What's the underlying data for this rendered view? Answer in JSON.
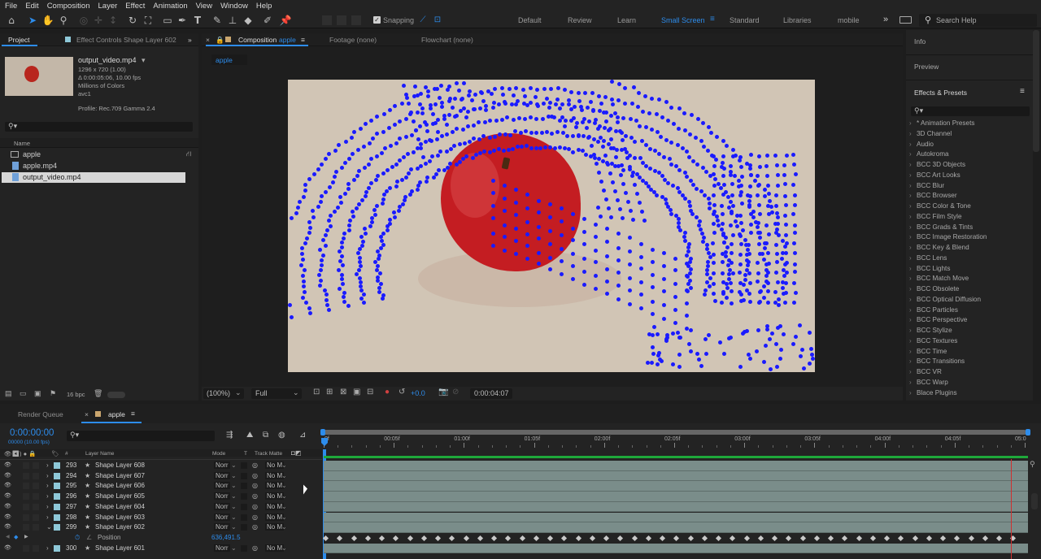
{
  "menu": [
    "File",
    "Edit",
    "Composition",
    "Layer",
    "Effect",
    "Animation",
    "View",
    "Window",
    "Help"
  ],
  "toolbar": {
    "snapping_label": "Snapping"
  },
  "workspaces": [
    "Default",
    "Review",
    "Learn",
    "Small Screen",
    "Standard",
    "Libraries",
    "mobile"
  ],
  "active_workspace": "Small Screen",
  "help": {
    "placeholder": "Search Help"
  },
  "project": {
    "tab_project": "Project",
    "tab_effect_controls": "Effect Controls Shape Layer 602",
    "file_name": "output_video.mp4",
    "file_details": [
      "1296 x 720 (1.00)",
      "Δ 0:00:05:06, 10.00 fps",
      "Millions of Colors",
      "avc1"
    ],
    "profile": "Profile: Rec.709 Gamma 2.4",
    "col_name": "Name",
    "items": [
      "apple",
      "apple.mp4",
      "output_video.mp4"
    ],
    "bpc": "16 bpc"
  },
  "composition": {
    "tab_label": "Composition",
    "comp_name": "apple",
    "footage_tab": "Footage (none)",
    "flowchart_tab": "Flowchart (none)",
    "crumb": "apple",
    "zoom": "(100%)",
    "resolution": "Full",
    "exposure": "+0.0",
    "timecode": "0:00:04:07"
  },
  "right_panel": {
    "info": "Info",
    "preview": "Preview",
    "effects_title": "Effects & Presets",
    "effects": [
      "* Animation Presets",
      "3D Channel",
      "Audio",
      "Autokroma",
      "BCC 3D Objects",
      "BCC Art Looks",
      "BCC Blur",
      "BCC Browser",
      "BCC Color & Tone",
      "BCC Film Style",
      "BCC Grads & Tints",
      "BCC Image Restoration",
      "BCC Key & Blend",
      "BCC Lens",
      "BCC Lights",
      "BCC Match Move",
      "BCC Obsolete",
      "BCC Optical Diffusion",
      "BCC Particles",
      "BCC Perspective",
      "BCC Stylize",
      "BCC Textures",
      "BCC Time",
      "BCC Transitions",
      "BCC VR",
      "BCC Warp",
      "Blace Plugins"
    ]
  },
  "timeline": {
    "render_queue": "Render Queue",
    "comp_tab": "apple",
    "timecode": "0:00:00:00",
    "fps": "00000 (10.00 fps)",
    "col_layer_name": "Layer Name",
    "col_mode": "Mode",
    "col_t": "T",
    "col_track_matte": "Track Matte",
    "ruler": [
      "0f",
      "00:05f",
      "01:00f",
      "01:05f",
      "02:00f",
      "02:05f",
      "03:00f",
      "03:05f",
      "04:00f",
      "04:05f",
      "05:0"
    ],
    "layers": [
      {
        "num": "293",
        "name": "Shape Layer 608",
        "mode": "Norr",
        "matte": "No M"
      },
      {
        "num": "294",
        "name": "Shape Layer 607",
        "mode": "Norr",
        "matte": "No M"
      },
      {
        "num": "295",
        "name": "Shape Layer 606",
        "mode": "Norr",
        "matte": "No M"
      },
      {
        "num": "296",
        "name": "Shape Layer 605",
        "mode": "Norr",
        "matte": "No M"
      },
      {
        "num": "297",
        "name": "Shape Layer 604",
        "mode": "Norr",
        "matte": "No M"
      },
      {
        "num": "298",
        "name": "Shape Layer 603",
        "mode": "Norr",
        "matte": "No M"
      },
      {
        "num": "299",
        "name": "Shape Layer 602",
        "mode": "Norr",
        "matte": "No M"
      }
    ],
    "position_label": "Position",
    "position_value": "636,491.5",
    "last_layer": {
      "num": "300",
      "name": "Shape Layer 601",
      "mode": "Norr",
      "matte": "No M"
    }
  },
  "colors": {
    "accent": "#2d8ceb",
    "dots": "#1a1aff",
    "track": "#7a8d8a",
    "playhead": "#d03030"
  }
}
